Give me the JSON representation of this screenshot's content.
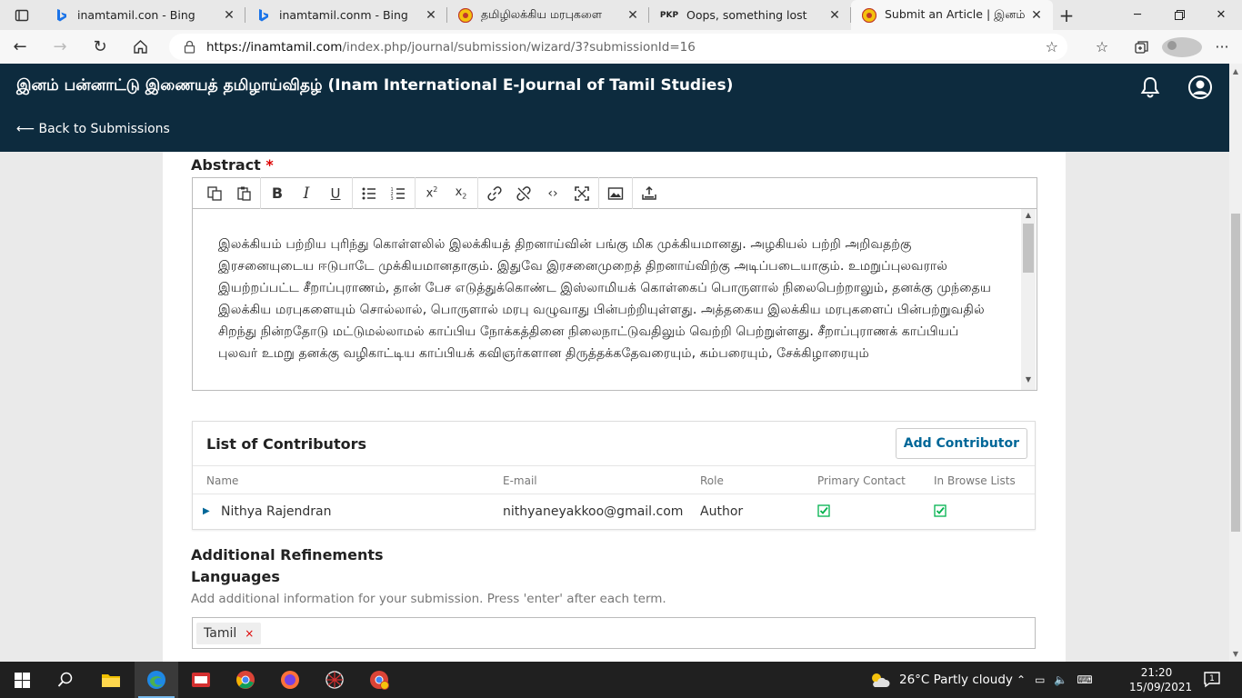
{
  "browser": {
    "tabs": [
      {
        "title": "inamtamil.con - Bing",
        "icon": "bing-icon"
      },
      {
        "title": "inamtamil.conm - Bing",
        "icon": "bing-icon"
      },
      {
        "title": "தமிழிலக்கிய மரபுகளை",
        "icon": "inam-icon"
      },
      {
        "title": "Oops, something lost",
        "icon": "pkp-icon"
      },
      {
        "title": "Submit an Article | இனம் பட",
        "icon": "inam-icon"
      }
    ],
    "pkp_label": "PKP",
    "url_host": "https://inamtamil.com",
    "url_path": "/index.php/journal/submission/wizard/3?submissionId=16"
  },
  "header": {
    "journal_title": "இனம் பன்னாட்டு இணையத் தமிழாய்விதழ் (Inam International E-Journal of Tamil Studies)",
    "back_link": "⟵ Back to Submissions"
  },
  "abstract": {
    "label": "Abstract",
    "required_mark": "*",
    "text": "இலக்கியம் பற்றிய புரிந்து கொள்ளலில் இலக்கியத் திறனாய்வின் பங்கு மிக முக்கியமானது. அழகியல் பற்றி அறிவதற்கு இரசனையுடைய ஈடுபாடே முக்கியமானதாகும். இதுவே இரசனைமுறைத் திறனாய்விற்கு அடிப்படையாகும். உமறுப்புலவரால் இயற்றப்பட்ட சீறாப்புராணம், தான் பேச எடுத்துக்கொண்ட இஸ்லாமியக் கொள்கைப் பொருளால் நிலைபெற்றாலும், தனக்கு முந்தைய இலக்கிய மரபுகளையும் சொல்லால், பொருளால் மரபு வழுவாது பின்பற்றியுள்ளது. அத்தகைய இலக்கிய மரபுகளைப் பின்பற்றுவதில் சிறந்து நின்றதோடு மட்டுமல்லாமல் காப்பிய நோக்கத்தினை நிலைநாட்டுவதிலும் வெற்றி பெற்றுள்ளது. சீறாப்புராணக் காப்பியப் புலவர் உமறு தனக்கு வழிகாட்டிய காப்பியக் கவிஞர்களான திருத்தக்கதேவரையும், கம்பரையும், சேக்கிழாரையும்"
  },
  "contributors": {
    "title": "List of Contributors",
    "add_button": "Add Contributor",
    "columns": [
      "Name",
      "E-mail",
      "Role",
      "Primary Contact",
      "In Browse Lists"
    ],
    "rows": [
      {
        "name": "Nithya Rajendran",
        "email": "nithyaneyakkoo@gmail.com",
        "role": "Author",
        "primary_contact": true,
        "in_browse_lists": true
      }
    ]
  },
  "refinements": {
    "title": "Additional Refinements",
    "languages_label": "Languages",
    "languages_help": "Add additional information for your submission. Press 'enter' after each term.",
    "tags": [
      "Tamil"
    ],
    "tag_remove": "×"
  },
  "taskbar": {
    "weather": "26°C  Partly cloudy",
    "time": "21:20",
    "date": "15/09/2021",
    "notification_count": "1"
  },
  "colors": {
    "header_bg": "#0d2b3e",
    "link": "#006798",
    "required": "#dd0000",
    "check": "#00b24e"
  }
}
